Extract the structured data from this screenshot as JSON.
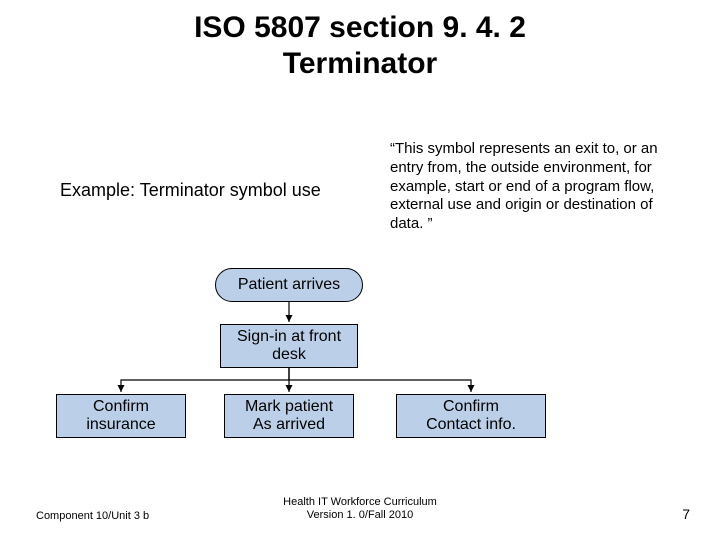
{
  "title_line1": "ISO 5807 section 9. 4. 2",
  "title_line2": "Terminator",
  "subtitle": "Example: Terminator symbol use",
  "quote": "“This symbol represents an exit to, or an entry from, the outside environment, for example, start or end of a program flow, external use and origin or destination of data. ”",
  "nodes": {
    "start": "Patient arrives",
    "signin": "Sign-in at front\ndesk",
    "confirm_insurance": "Confirm\ninsurance",
    "mark_arrived": "Mark patient\nAs arrived",
    "confirm_contact": "Confirm\nContact info."
  },
  "footer": {
    "left": "Component 10/Unit 3 b",
    "center_line1": "Health IT Workforce Curriculum",
    "center_line2": "Version 1. 0/Fall 2010",
    "right": "7"
  },
  "colors": {
    "node_fill": "#bbd0e8",
    "node_border": "#000000"
  }
}
